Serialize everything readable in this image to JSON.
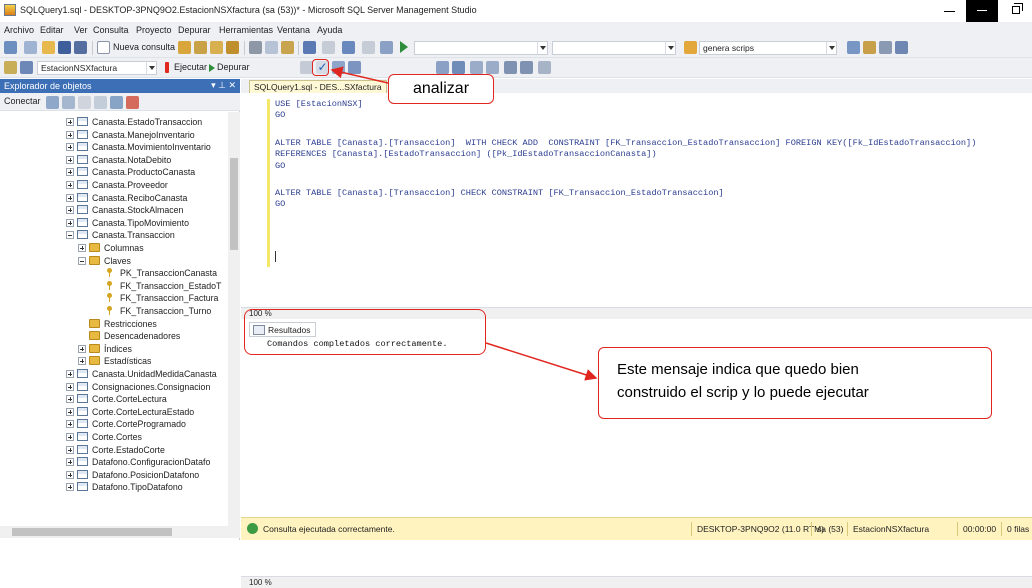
{
  "window": {
    "title": "SQLQuery1.sql - DESKTOP-3PNQ9O2.EstacionNSXfactura (sa (53))* - Microsoft SQL Server Management Studio"
  },
  "menu": [
    "Archivo",
    "Editar",
    "Ver",
    "Consulta",
    "Proyecto",
    "Depurar",
    "Herramientas",
    "Ventana",
    "Ayuda"
  ],
  "toolbar": {
    "new_query": "Nueva consulta",
    "execute": "Ejecutar",
    "debug": "Depurar",
    "database": "EstacionNSXfactura",
    "find_combo": "genera scrips"
  },
  "explorer": {
    "title": "Explorador de objetos",
    "connect": "Conectar",
    "items": [
      {
        "label": "Canasta.EstadoTransaccion",
        "kind": "table"
      },
      {
        "label": "Canasta.ManejoInventario",
        "kind": "table"
      },
      {
        "label": "Canasta.MovimientoInventario",
        "kind": "table"
      },
      {
        "label": "Canasta.NotaDebito",
        "kind": "table"
      },
      {
        "label": "Canasta.ProductoCanasta",
        "kind": "table"
      },
      {
        "label": "Canasta.Proveedor",
        "kind": "table"
      },
      {
        "label": "Canasta.ReciboCanasta",
        "kind": "table"
      },
      {
        "label": "Canasta.StockAlmacen",
        "kind": "table"
      },
      {
        "label": "Canasta.TipoMovimiento",
        "kind": "table"
      },
      {
        "label": "Canasta.Transaccion",
        "kind": "table-open"
      },
      {
        "label": "Columnas",
        "kind": "folder"
      },
      {
        "label": "Claves",
        "kind": "folder-open"
      },
      {
        "label": "PK_TransaccionCanasta",
        "kind": "key"
      },
      {
        "label": "FK_Transaccion_EstadoT",
        "kind": "key"
      },
      {
        "label": "FK_Transaccion_Factura",
        "kind": "key"
      },
      {
        "label": "FK_Transaccion_Turno",
        "kind": "key"
      },
      {
        "label": "Restricciones",
        "kind": "folder-leaf"
      },
      {
        "label": "Desencadenadores",
        "kind": "folder-leaf"
      },
      {
        "label": "Índices",
        "kind": "folder"
      },
      {
        "label": "Estadísticas",
        "kind": "folder"
      },
      {
        "label": "Canasta.UnidadMedidaCanasta",
        "kind": "table"
      },
      {
        "label": "Consignaciones.Consignacion",
        "kind": "table"
      },
      {
        "label": "Corte.CorteLectura",
        "kind": "table"
      },
      {
        "label": "Corte.CorteLecturaEstado",
        "kind": "table"
      },
      {
        "label": "Corte.CorteProgramado",
        "kind": "table"
      },
      {
        "label": "Corte.Cortes",
        "kind": "table"
      },
      {
        "label": "Corte.EstadoCorte",
        "kind": "table"
      },
      {
        "label": "Datafono.ConfiguracionDatafo",
        "kind": "table"
      },
      {
        "label": "Datafono.PosicionDatafono",
        "kind": "table"
      },
      {
        "label": "Datafono.TipoDatafono",
        "kind": "table"
      }
    ]
  },
  "editor": {
    "tab": "SQLQuery1.sql - DES...SXfactura",
    "lines": [
      "USE [EstacionNSX]",
      "GO",
      "",
      "ALTER TABLE [Canasta].[Transaccion]  WITH CHECK ADD  CONSTRAINT [FK_Transaccion_EstadoTransaccion] FOREIGN KEY([Fk_IdEstadoTransaccion])",
      "REFERENCES [Canasta].[EstadoTransaccion] ([Pk_IdEstadoTransaccionCanasta])",
      "GO",
      "",
      "ALTER TABLE [Canasta].[Transaccion] CHECK CONSTRAINT [FK_Transaccion_EstadoTransaccion]",
      "GO"
    ],
    "zoom": "100 %"
  },
  "results": {
    "tab": "Resultados",
    "message": "Comandos completados correctamente.",
    "zoom": "100 %"
  },
  "status": {
    "message": "Consulta ejecutada correctamente.",
    "server": "DESKTOP-3PNQ9O2 (11.0 RTM)",
    "user": "sa (53)",
    "database": "EstacionNSXfactura",
    "time": "00:00:00",
    "rows": "0 filas"
  },
  "annotations": {
    "analizar": "analizar",
    "explanation_line1": "Este mensaje indica que quedo bien",
    "explanation_line2": "construido el scrip y lo puede ejecutar"
  },
  "colors": {
    "accent": "#3c6fb6",
    "annotation_red": "#e0271f",
    "status_bg": "#fff4c0"
  }
}
